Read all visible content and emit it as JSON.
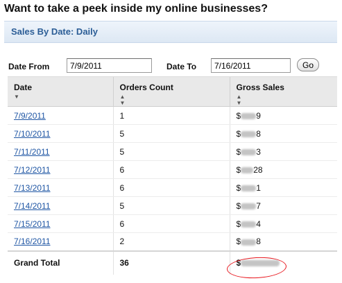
{
  "headline": "Want to take a peek inside my online businesses?",
  "panel": {
    "title": "Sales By Date: Daily"
  },
  "filters": {
    "date_from_label": "Date From",
    "date_from_value": "7/9/2011",
    "date_to_label": "Date To",
    "date_to_value": "7/16/2011",
    "go_label": "Go"
  },
  "table": {
    "columns": [
      "Date",
      "Orders Count",
      "Gross Sales"
    ],
    "rows": [
      {
        "date": "7/9/2011",
        "orders": "1",
        "sales_prefix": "$",
        "sales_visible": "9"
      },
      {
        "date": "7/10/2011",
        "orders": "5",
        "sales_prefix": "$",
        "sales_visible": "8"
      },
      {
        "date": "7/11/2011",
        "orders": "5",
        "sales_prefix": "$",
        "sales_visible": "3"
      },
      {
        "date": "7/12/2011",
        "orders": "6",
        "sales_prefix": "$",
        "sales_visible": "28"
      },
      {
        "date": "7/13/2011",
        "orders": "6",
        "sales_prefix": "$",
        "sales_visible": "1"
      },
      {
        "date": "7/14/2011",
        "orders": "5",
        "sales_prefix": "$",
        "sales_visible": "7"
      },
      {
        "date": "7/15/2011",
        "orders": "6",
        "sales_prefix": "$",
        "sales_visible": "4"
      },
      {
        "date": "7/16/2011",
        "orders": "2",
        "sales_prefix": "$",
        "sales_visible": "8"
      }
    ],
    "total": {
      "label": "Grand Total",
      "orders": "36",
      "sales_prefix": "$"
    }
  },
  "icons": {
    "sort": "sort-arrows-icon"
  },
  "colors": {
    "link": "#1f56a4",
    "panel_title": "#2b5d96",
    "annotation": "#e8141b"
  }
}
